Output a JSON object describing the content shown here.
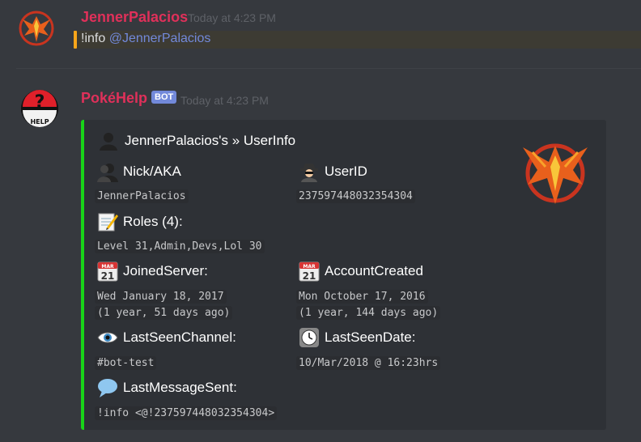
{
  "messages": [
    {
      "username": "JennerPalacios",
      "timestamp": "Today at 4:23 PM",
      "command": "!info",
      "mention": "@JennerPalacios"
    },
    {
      "username": "PokéHelp",
      "bot_tag": "BOT",
      "timestamp": "Today at 4:23 PM"
    }
  ],
  "embed": {
    "accent_color": "#19d319",
    "title": "JennerPalacios's » UserInfo",
    "fields": {
      "nick_name": "Nick/AKA",
      "nick_value": "JennerPalacios",
      "userid_name": "UserID",
      "userid_value": "237597448032354304",
      "roles_name": "Roles (4):",
      "roles_value": "Level 31,Admin,Devs,Lol 30",
      "joined_name": "JoinedServer:",
      "joined_value1": "Wed January 18, 2017",
      "joined_value2": "(1 year, 51 days ago)",
      "created_name": "AccountCreated",
      "created_value1": "Mon October 17, 2016",
      "created_value2": "(1 year, 144 days ago)",
      "cal_month": "MAR",
      "cal_day": "21",
      "lastchan_name": "LastSeenChannel:",
      "lastchan_value": "#bot-test",
      "lastdate_name": "LastSeenDate:",
      "lastdate_value": "10/Mar/2018 @ 16:23hrs",
      "lastmsg_name": "LastMessageSent:",
      "lastmsg_value": "!info <@!237597448032354304>"
    }
  },
  "avatar_text": "HELP",
  "icons": [
    "phoenix-avatar-icon",
    "pokeball-help-avatar-icon",
    "bust-silhouette-icon",
    "spy-icon",
    "memo-icon",
    "calendar-icon",
    "eye-icon",
    "clock-icon",
    "speech-balloon-icon"
  ]
}
